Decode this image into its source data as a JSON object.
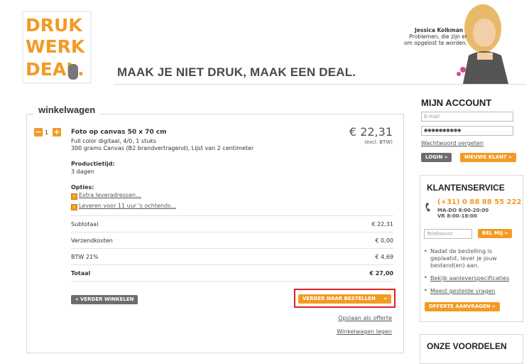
{
  "header": {
    "logo": {
      "lines": [
        "DRUK",
        "WERK",
        "DEAL."
      ],
      "color": "#f39a24"
    },
    "tagline": "MAAK JE NIET DRUK, MAAK EEN DEAL.",
    "persona": {
      "name": "Jessica Kolkman",
      "text": "Problemen, die zijn er om opgelost te worden."
    }
  },
  "cart": {
    "title": "winkelwagen",
    "item": {
      "qty_minus": "−",
      "qty_plus": "+",
      "quantity": "1",
      "name": "Foto op canvas 50 x 70 cm",
      "lines": [
        "Full color digitaal, 4/0, 1 stuks",
        "300 grams Canvas (B2 brandvertragend), Lijst van 2 centimeter"
      ],
      "price": "€ 22,31",
      "price_note": "(excl. BTW)",
      "production_label": "Productietijd:",
      "production_value": "3 dagen",
      "options_label": "Opties:",
      "options": [
        "Extra leveradressen...",
        "Leveren voor 11 uur 's ochtends..."
      ]
    },
    "summary": [
      {
        "label": "Subtotaal",
        "value": "€ 22,31",
        "bold": false
      },
      {
        "label": "Verzendkosten",
        "value": "€ 0,00",
        "bold": false
      },
      {
        "label": "BTW 21%",
        "value": "€ 4,69",
        "bold": false
      },
      {
        "label": "Totaal",
        "value": "€ 27,00",
        "bold": true
      }
    ],
    "continue_label": "VERDER WINKELEN",
    "checkout_label": "VERDER NAAR BESTELLEN",
    "save_quote": "Opslaan als offerte",
    "empty_cart": "Winkelwagen legen"
  },
  "account": {
    "title": "MIJN ACCOUNT",
    "email_placeholder": "E-mail",
    "password_value": "●●●●●●●●●●",
    "forgot": "Wachtwoord vergeten",
    "login": "LOGIN",
    "new_customer": "NIEUWE KLANT"
  },
  "service": {
    "title": "KLANTENSERVICE",
    "phone": "(+31) 0 88 88 55 222",
    "hours": [
      "MA-DO 8:00-20:00",
      "VR 8:00-18:00"
    ],
    "phone_placeholder": "Telefoonnr.",
    "call_me": "BEL MIJ",
    "info": "Nadat de bestelling is geplaatst, lever je jouw bestand(en) aan.",
    "links": [
      "Bekijk aanleverspecificaties",
      "Meest gestelde vragen"
    ],
    "quote_button": "OFFERTE AANVRAGEN"
  },
  "benefits": {
    "title": "ONZE VOORDELEN"
  },
  "colors": {
    "accent": "#f39a24",
    "grey_button": "#6d6d6d",
    "highlight": "#e02020"
  }
}
